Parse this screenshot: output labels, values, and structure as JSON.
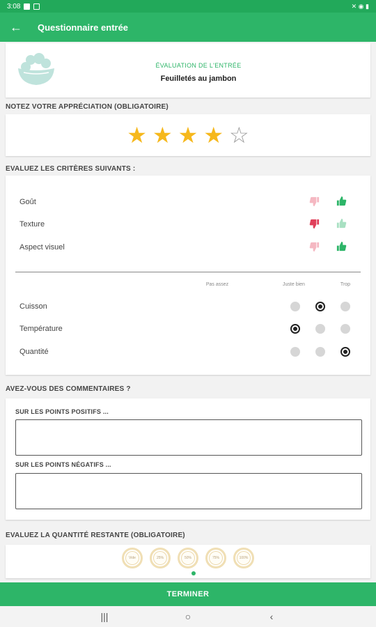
{
  "status_bar": {
    "time": "3:08",
    "right": "✕ ◉ ▮"
  },
  "app_bar": {
    "title": "Questionnaire entrée"
  },
  "header": {
    "eval_title": "ÉVALUATION DE L'ENTRÉE",
    "dish": "Feuilletés au jambon"
  },
  "rating": {
    "label": "NOTEZ VOTRE APPRÉCIATION (OBLIGATOIRE)",
    "value": 4,
    "max": 5
  },
  "criteria": {
    "label": "EVALUEZ LES CRITÈRES SUIVANTS :",
    "thumb_items": [
      {
        "label": "Goût",
        "selected": "up"
      },
      {
        "label": "Texture",
        "selected": "down"
      },
      {
        "label": "Aspect visuel",
        "selected": "up"
      }
    ],
    "columns": [
      "Pas assez",
      "Juste bien",
      "Trop"
    ],
    "radio_items": [
      {
        "label": "Cuisson",
        "selected": 1
      },
      {
        "label": "Température",
        "selected": 0
      },
      {
        "label": "Quantité",
        "selected": 2
      }
    ]
  },
  "comments": {
    "label": "AVEZ-VOUS DES COMMENTAIRES ?",
    "positive_label": "SUR LES POINTS POSITIFS ...",
    "positive_value": "",
    "negative_label": "SUR LES POINTS NÉGATIFS ...",
    "negative_value": ""
  },
  "quantity": {
    "label": "EVALUEZ LA QUANTITÉ RESTANTE (OBLIGATOIRE)",
    "options": [
      "Vide",
      "25%",
      "50%",
      "75%",
      "100%"
    ]
  },
  "finish_label": "TERMINER",
  "colors": {
    "primary": "#2db568",
    "star": "#f6b81c",
    "thumb_down": "#e0405a",
    "thumb_up": "#2db568"
  },
  "nav": {
    "recents": "|||",
    "home": "○",
    "back": "‹"
  }
}
